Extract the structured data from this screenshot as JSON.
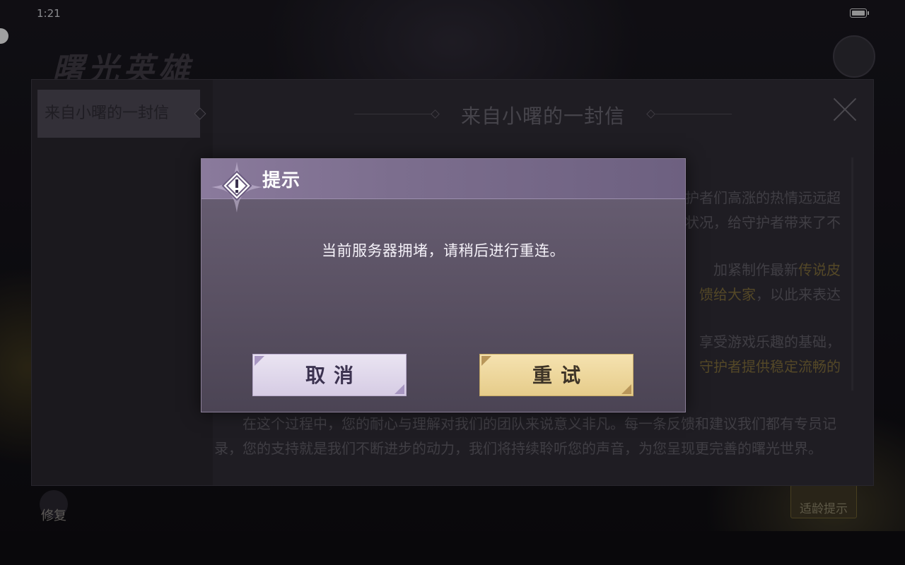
{
  "status_bar": {
    "time": "1:21"
  },
  "background": {
    "logo_text": "曙光英雄",
    "repair_label": "修复",
    "age_tip_label": "适龄提示"
  },
  "letter": {
    "sidebar_tab": "来自小曙的一封信",
    "title": "来自小曙的一封信",
    "paragraphs": [
      {
        "text": "护者们高涨的热情远远超",
        "highlight": ""
      },
      {
        "text": "状况，给守护者带来了不",
        "highlight": ""
      },
      {
        "text": "加紧制作最新",
        "highlight": "传说皮"
      },
      {
        "text": "",
        "highlight": "馈给大家",
        "tail": "，以此来表达"
      },
      {
        "text": "享受游戏乐趣的基础，",
        "highlight": ""
      },
      {
        "text": "",
        "highlight": "守护者提供稳定流畅的",
        "tail": ""
      },
      {
        "text": "在这个过程中，您的耐心与理解对我们的团队来说意义非凡。每一条反馈和建议我们都有专员记录，您的支持就是我们不断进步的动力，我们将持续聆听您的声音，为您呈现更完善的曙光世界。",
        "highlight": ""
      }
    ]
  },
  "dialog": {
    "title": "提示",
    "message": "当前服务器拥堵，请稍后进行重连。",
    "cancel_label": "取消",
    "retry_label": "重试"
  },
  "colors": {
    "dialog_bg": "#5a5163",
    "header_bg": "#8a7a9c",
    "cancel_bg": "#e2d9ee",
    "retry_bg": "#efd79c",
    "highlight_text": "#7d6a36"
  },
  "icons": {
    "dialog_header": "warning-star-icon",
    "close": "close-icon",
    "battery": "battery-charging-icon"
  }
}
